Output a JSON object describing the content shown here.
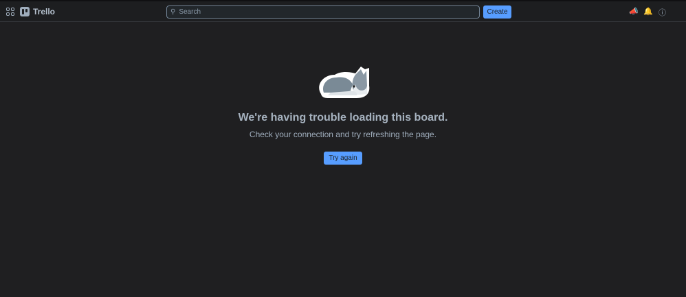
{
  "app": {
    "name": "Trello"
  },
  "header": {
    "search_placeholder": "Search",
    "create_label": "Create"
  },
  "error": {
    "title": "We're having trouble loading this board.",
    "message": "Check your connection and try refreshing the page.",
    "retry_label": "Try again"
  }
}
